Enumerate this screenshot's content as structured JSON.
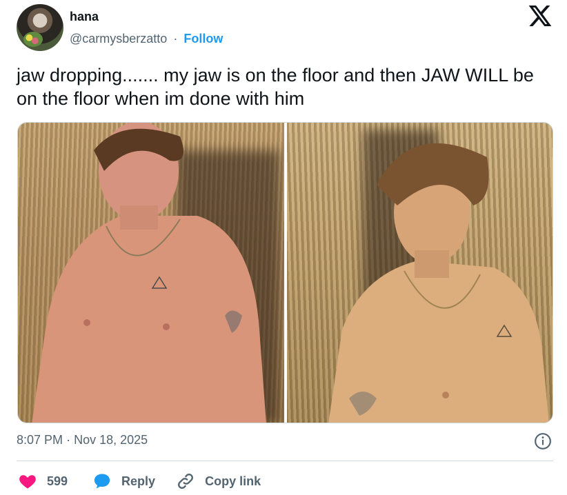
{
  "author": {
    "name": "hana",
    "handle": "@carmysberzatto",
    "separator": "·",
    "follow_label": "Follow"
  },
  "tweet": {
    "text": "jaw dropping....... my jaw is on the floor and then JAW WILL be on the floor when im done with him"
  },
  "meta": {
    "time": "8:07 PM",
    "separator": "·",
    "date": "Nov 18, 2025"
  },
  "actions": {
    "like_count": "599",
    "reply_label": "Reply",
    "copy_label": "Copy link"
  },
  "colors": {
    "accent": "#1d9bf0",
    "like": "#f91880",
    "text": "#0f1419",
    "muted": "#536471"
  },
  "icons": {
    "brand": "x-logo-icon",
    "info": "info-icon",
    "like": "heart-icon",
    "reply": "speech-bubble-icon",
    "copy": "link-icon"
  }
}
